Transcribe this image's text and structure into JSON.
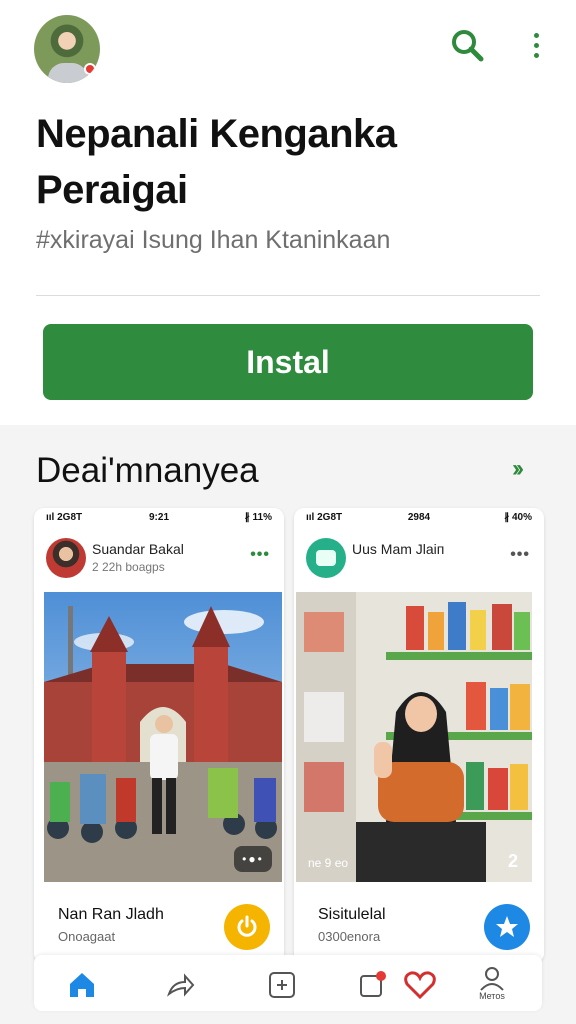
{
  "header": {
    "avatar_icon": "profile-avatar",
    "search_icon": "search-icon",
    "menu_icon": "more-vert-icon",
    "accent_color": "#2e8b3d"
  },
  "app": {
    "title_line1": "Nepanali Kenganka",
    "title_line2": "Peraigai",
    "subtitle": "#xkirayai Isung Ihan Ktaninkaan",
    "install_label": "Instal",
    "install_color": "#2f8b3e"
  },
  "screenshots_section": {
    "title": "Deai'mnanyea",
    "arrow": "››"
  },
  "cards": [
    {
      "status": {
        "signal": "ııl 2G8T",
        "time": "9:21",
        "battery": "∦ 11%"
      },
      "name": "Suandar Bakal",
      "meta": "2 22h boagps",
      "image_button": "•●•",
      "footer_name": "Nan Ran Jladh",
      "footer_sub": "Onoagaat",
      "fab_icon": "power-icon"
    },
    {
      "status": {
        "signal": "ııl 2G8T",
        "time": "2984",
        "battery": "∦ 40%"
      },
      "name": "Uus Mam Jlaiп",
      "meta": "",
      "image_text": "ne 9 eo",
      "image_count": "2",
      "footer_name": "Sisitulelal",
      "footer_sub": "0300enora",
      "fab_icon": "star-icon"
    }
  ],
  "bottom_nav": {
    "items": [
      "home-icon",
      "share-icon",
      "add-icon",
      "notification-icon",
      "heart-icon",
      "profile-icon"
    ],
    "profile_label": "Mетos"
  }
}
